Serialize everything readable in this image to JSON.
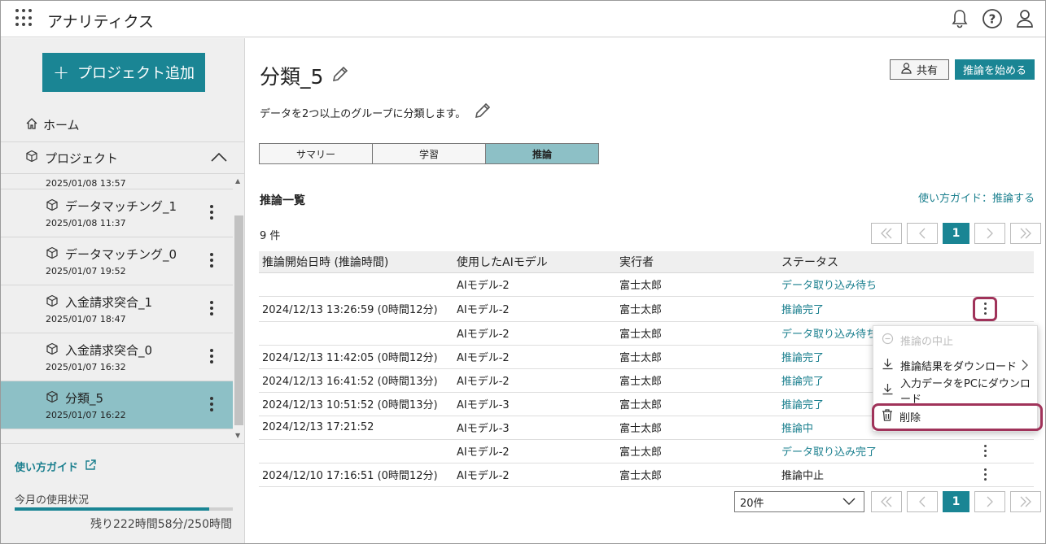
{
  "header": {
    "app_title": "アナリティクス",
    "icons": [
      "apps-grid-icon",
      "bell-icon",
      "help-icon",
      "user-icon"
    ]
  },
  "sidebar": {
    "add_button": "プロジェクト追加",
    "home": "ホーム",
    "projects": "プロジェクト",
    "partial_item_date": "2025/01/08 13:57",
    "items": [
      {
        "name": "データマッチング_1",
        "date": "2025/01/08 11:37",
        "active": false
      },
      {
        "name": "データマッチング_0",
        "date": "2025/01/07 19:52",
        "active": false
      },
      {
        "name": "入金請求突合_1",
        "date": "2025/01/07 18:47",
        "active": false
      },
      {
        "name": "入金請求突合_0",
        "date": "2025/01/07 16:32",
        "active": false
      },
      {
        "name": "分類_5",
        "date": "2025/01/07 16:22",
        "active": true
      }
    ],
    "guide": "使い方ガイド",
    "usage_label": "今月の使用状況",
    "usage_fraction": 0.89,
    "usage_remaining": "残り222時間58分/250時間"
  },
  "main": {
    "title": "分類_5",
    "description": "データを2つ以上のグループに分類します。",
    "share_button": "共有",
    "start_button": "推論を始める",
    "tabs": [
      {
        "label": "サマリー",
        "active": false
      },
      {
        "label": "学習",
        "active": false
      },
      {
        "label": "推論",
        "active": true
      }
    ],
    "section_title": "推論一覧",
    "guide_link": "使い方ガイド：推論する",
    "count": "9 件",
    "pager": {
      "first": "«",
      "prev": "‹",
      "current": "1",
      "next": "›",
      "last": "»"
    },
    "columns": [
      "推論開始日時 (推論時間)",
      "使用したAIモデル",
      "実行者",
      "ステータス"
    ],
    "rows": [
      {
        "start": "",
        "model": "AIモデル-2",
        "user": "富士太郎",
        "status": "データ取り込み待ち",
        "link": true,
        "kebab": false
      },
      {
        "start": "2024/12/13 13:26:59 (0時間12分)",
        "model": "AIモデル-2",
        "user": "富士太郎",
        "status": "推論完了",
        "link": true,
        "kebab": true,
        "highlight": true
      },
      {
        "start": "",
        "model": "AIモデル-2",
        "user": "富士太郎",
        "status": "データ取り込み待ち",
        "link": true,
        "kebab": false
      },
      {
        "start": "2024/12/13 11:42:05 (0時間12分)",
        "model": "AIモデル-2",
        "user": "富士太郎",
        "status": "推論完了",
        "link": true,
        "kebab": false
      },
      {
        "start": "2024/12/13 16:41:52 (0時間13分)",
        "model": "AIモデル-2",
        "user": "富士太郎",
        "status": "推論完了",
        "link": true,
        "kebab": false
      },
      {
        "start": "2024/12/13 10:51:52 (0時間13分)",
        "model": "AIモデル-3",
        "user": "富士太郎",
        "status": "推論完了",
        "link": true,
        "kebab": false
      },
      {
        "start": "2024/12/13 17:21:52",
        "model": "AIモデル-3",
        "user": "富士太郎",
        "status": "推論中",
        "link": true,
        "kebab": false
      },
      {
        "start": "",
        "model": "AIモデル-2",
        "user": "富士太郎",
        "status": "データ取り込み完了",
        "link": true,
        "kebab": true
      },
      {
        "start": "2024/12/10 17:16:51 (0時間12分)",
        "model": "AIモデル-2",
        "user": "富士太郎",
        "status": "推論中止",
        "link": false,
        "kebab": true
      }
    ],
    "page_size": "20件"
  },
  "context_menu": {
    "items": [
      {
        "label": "推論の中止",
        "icon": "minus-circle-icon",
        "disabled": true
      },
      {
        "label": "推論結果をダウンロード",
        "icon": "download-icon",
        "disabled": false,
        "submenu": true
      },
      {
        "label": "入力データをPCにダウンロード",
        "icon": "download-icon",
        "disabled": false
      },
      {
        "label": "削除",
        "icon": "trash-icon",
        "disabled": false,
        "highlight": true
      }
    ]
  },
  "colors": {
    "accent": "#1a8594",
    "active_bg": "#8dc0c6",
    "highlight": "#a0335a",
    "link": "#1a7f8e"
  }
}
